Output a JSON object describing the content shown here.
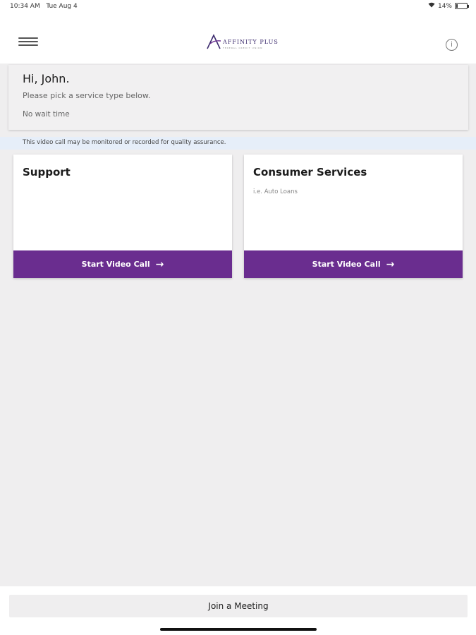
{
  "status_bar": {
    "time": "10:34 AM",
    "date": "Tue Aug 4",
    "battery": "14%",
    "battery_level": 0.14,
    "icons": [
      "wifi-icon",
      "battery-icon"
    ]
  },
  "header": {
    "logo_text": "AFFINITY PLUS",
    "logo_subtext": "FEDERAL CREDIT UNION",
    "brand_color": "#3b2a6d",
    "icons": [
      "hamburger-menu-icon",
      "info-icon"
    ]
  },
  "greeting": {
    "title": "Hi, John.",
    "subtitle": "Please pick a service type below.",
    "wait_time": "No wait time"
  },
  "notice": "This video call may be monitored or recorded for quality assurance.",
  "services": [
    {
      "title": "Support",
      "description": "",
      "button_label": "Start Video Call"
    },
    {
      "title": "Consumer Services",
      "description": "i.e. Auto Loans",
      "button_label": "Start Video Call"
    }
  ],
  "accent_color": "#6a2d8f",
  "footer": {
    "join_label": "Join a Meeting"
  }
}
